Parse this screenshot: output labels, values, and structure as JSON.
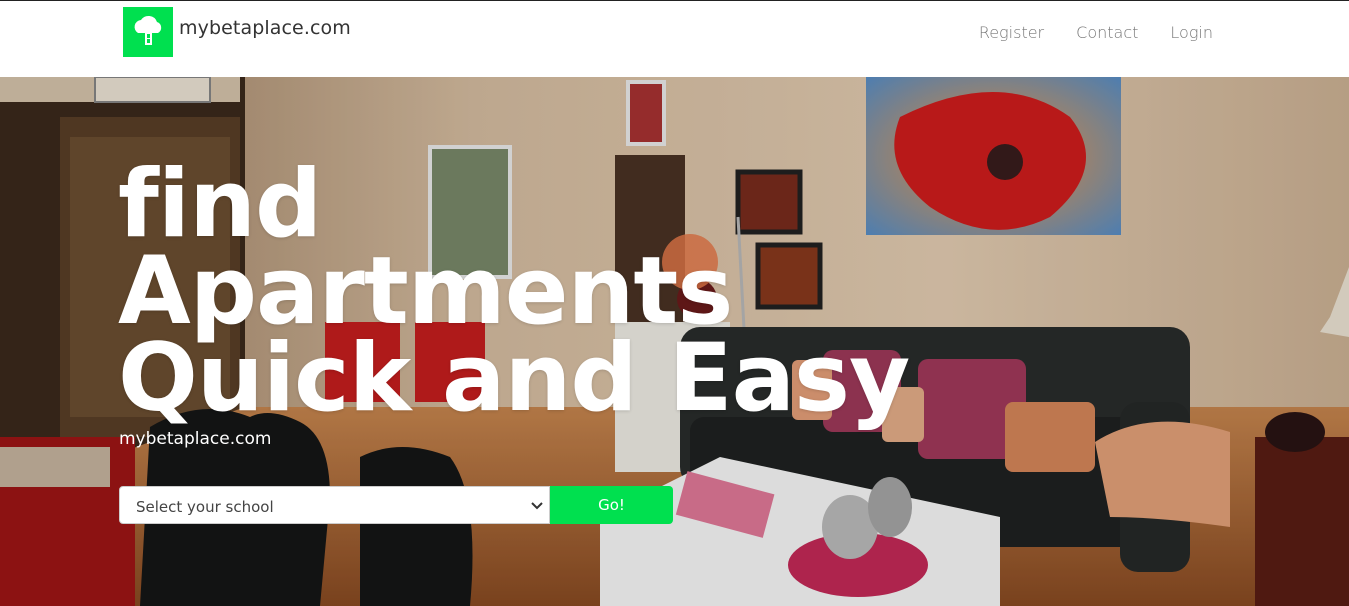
{
  "brand": {
    "name": "mybetaplace.com",
    "logo_icon": "cloud-house-icon",
    "logo_color": "#00e04f"
  },
  "nav": {
    "items": [
      {
        "label": "Register"
      },
      {
        "label": "Contact"
      },
      {
        "label": "Login"
      }
    ]
  },
  "hero": {
    "headline": [
      "find",
      "Apartments",
      "Quick and Easy"
    ],
    "subtitle": "mybetaplace.com",
    "search": {
      "select_value": "Select your school",
      "button_label": "Go!",
      "button_color": "#00e04f"
    }
  }
}
